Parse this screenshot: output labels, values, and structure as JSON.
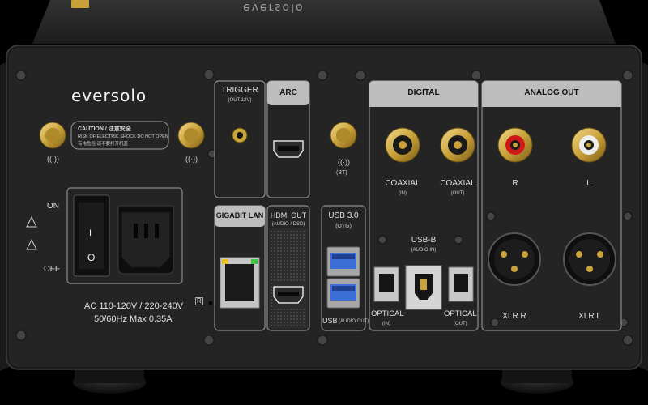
{
  "brand": "eversolo",
  "top_logo": "eversolo",
  "caution": {
    "title": "CAUTION / 注意安全",
    "line1": "RISK OF ELECTRIC SHOCK DO NOT OPEN",
    "line2": "有电危险,请不要打开机盖"
  },
  "power": {
    "on": "ON",
    "off": "OFF",
    "rating1": "AC 110-120V / 220-240V",
    "rating2": "50/60Hz Max 0.35A",
    "switch_on_mark": "I",
    "switch_off_mark": "O"
  },
  "trigger": {
    "title": "TRIGGER",
    "sub": "(OUT 12V)"
  },
  "arc": {
    "title": "ARC"
  },
  "gigabit": {
    "title": "GIGABIT LAN",
    "reset": "R"
  },
  "hdmi_out": {
    "title": "HDMI OUT",
    "sub": "(AUDIO / DSD)"
  },
  "bt": {
    "label": "(BT)"
  },
  "usb": {
    "title": "USB 3.0",
    "sub": "(OTG)",
    "bottom": "USB",
    "bottom_sub": "(AUDIO OUT)"
  },
  "digital": {
    "title": "DIGITAL",
    "coax_in": "COAXIAL",
    "coax_in_sub": "(IN)",
    "coax_out": "COAXIAL",
    "coax_out_sub": "(OUT)",
    "usbb": "USB-B",
    "usbb_sub": "(AUDIO IN)",
    "opt_in": "OPTICAL",
    "opt_in_sub": "(IN)",
    "opt_out": "OPTICAL",
    "opt_out_sub": "(OUT)"
  },
  "analog": {
    "title": "ANALOG OUT",
    "r": "R",
    "l": "L",
    "xlr_r": "XLR R",
    "xlr_l": "XLR L"
  },
  "colors": {
    "chassis": "#1b1b1b",
    "panel": "#222222",
    "gold": "#c9a23a",
    "red": "#d01818",
    "usb_blue": "#3b6fd6"
  }
}
